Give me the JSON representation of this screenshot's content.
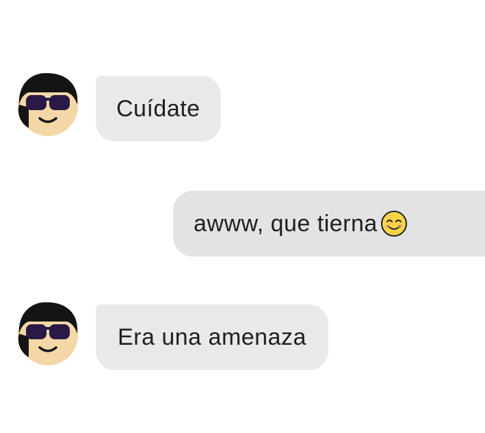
{
  "messages": [
    {
      "sender": "contact",
      "text": "Cuídate",
      "avatar_icon": "sunglasses-avatar-icon"
    },
    {
      "sender": "me",
      "text": "awww, que tierna",
      "emoji_icon": "smiling-face-emoji-icon"
    },
    {
      "sender": "contact",
      "text": "Era una amenaza",
      "avatar_icon": "sunglasses-avatar-icon"
    }
  ],
  "colors": {
    "bubble_incoming": "#e9e9eb",
    "bubble_outgoing": "#e3e3e6",
    "text": "#1f1f1f",
    "avatar_hair": "#141414",
    "avatar_skin": "#f3d7a6",
    "avatar_glasses": "#2a1846"
  }
}
